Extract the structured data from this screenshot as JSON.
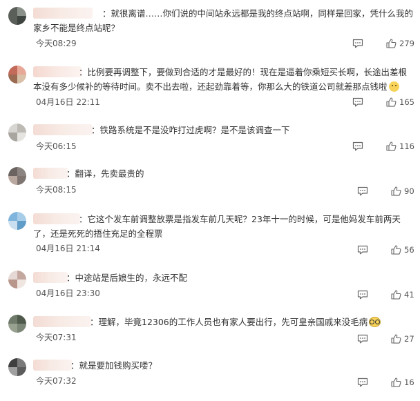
{
  "comments": [
    {
      "text": "：就很离谱……你们说的中间站永远都是我的终点站啊，同样是回家，凭什么我的家乡不能是终点站呢？",
      "time": "今天08:29",
      "likes": "279"
    },
    {
      "text": "：比例要再调整下，要做到合适的才是最好的！现在是逼着你乘短买长啊，长途出差根本没有多少候补的等待时间。卖不出去啦，还起劲靠着等，你那么大的铁道公司就差那点钱啦",
      "time": "04月16日 22:11",
      "likes": "165"
    },
    {
      "text": "：铁路系统是不是没咋打过虎啊？是不是该调查一下",
      "time": "今天06:15",
      "likes": "116"
    },
    {
      "text": "：翻译，先卖最贵的",
      "time": "今天08:15",
      "likes": "90"
    },
    {
      "text": "：它这个发车前调整放票是指发车前几天呢？23年十一的时候，可是他妈发车前两天了，还是死死的捂住充足的全程票",
      "time": "04月16日 21:14",
      "likes": "56"
    },
    {
      "text": "：中途站是后娘生的，永远不配",
      "time": "04月16日 23:30",
      "likes": "41"
    },
    {
      "text": "：理解，毕竟12306的工作人员也有家人要出行，先可皇亲国戚来没毛病",
      "time": "今天07:31",
      "likes": "27"
    },
    {
      "text": "：就是要加钱购买喽？",
      "time": "今天07:32",
      "likes": "16"
    }
  ],
  "colors": {
    "text": "#333333",
    "meta": "#555555",
    "icon": "#666666"
  }
}
